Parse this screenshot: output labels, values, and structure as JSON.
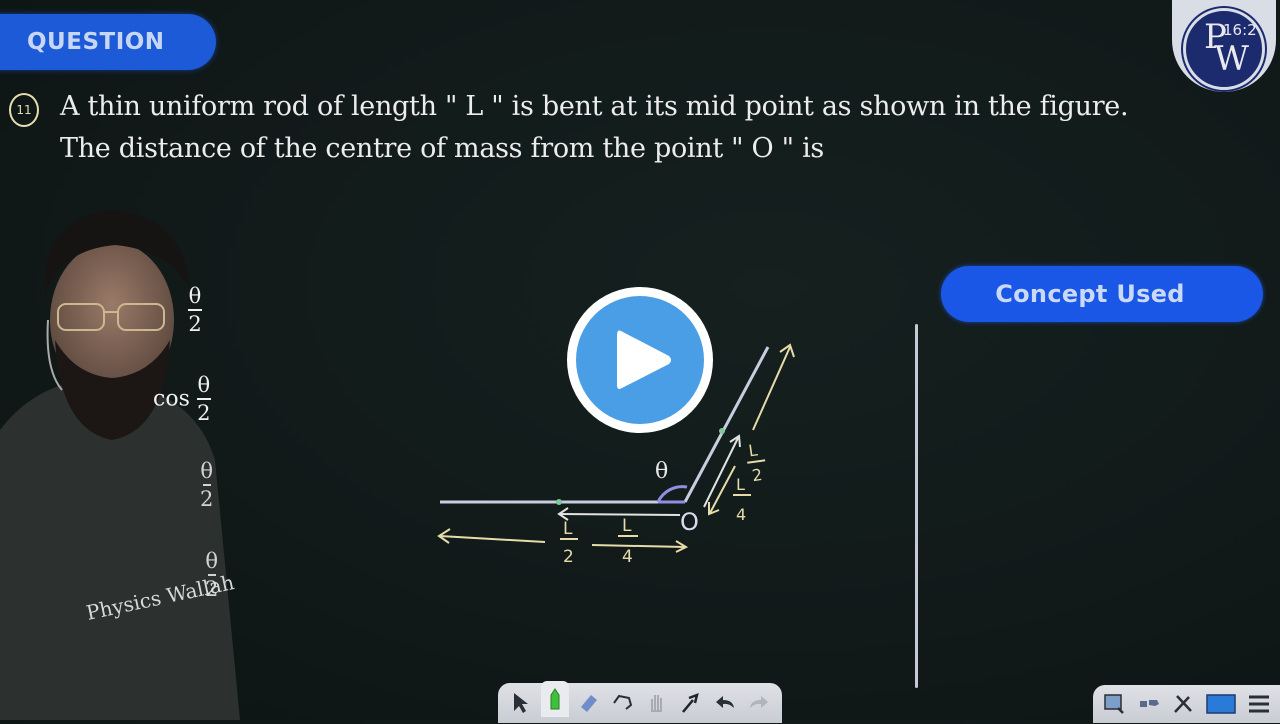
{
  "header": {
    "badge_label": "QUESTION",
    "logo_letters_top": "P",
    "logo_letters_bottom": "W",
    "timestamp_fragment": "16:2"
  },
  "question": {
    "number": "11",
    "line1": "A thin uniform rod of length \" L \" is bent at its mid point as shown in the figure.",
    "line2": "The distance of the centre of mass from the point \" O \" is"
  },
  "side_panel": {
    "concept_button_label": "Concept Used"
  },
  "options_fragments": [
    {
      "prefix": "",
      "num": "θ",
      "den": "2"
    },
    {
      "prefix": "cos",
      "num": "θ",
      "den": "2"
    },
    {
      "prefix": "",
      "num": "θ",
      "den": "2"
    },
    {
      "prefix": "",
      "num": "θ",
      "den": "2"
    }
  ],
  "presenter": {
    "shirt_text": "Physics Wallah"
  },
  "figure": {
    "angle_label": "θ",
    "point_label": "O",
    "labels": {
      "half_length_horizontal": {
        "num": "L",
        "den": "2"
      },
      "quarter_length_horizontal": {
        "num": "L",
        "den": "4"
      },
      "half_length_inclined": {
        "num": "L",
        "den": "2"
      },
      "quarter_length_inclined": {
        "num": "L",
        "den": "4"
      }
    },
    "colors": {
      "rod": "#c9cde0",
      "annotation": "#e6dcaa",
      "midpoint": "#7fc89a",
      "angle_arc": "#8f8fe0"
    }
  },
  "player": {
    "play_button_color": "#4a9ee6"
  },
  "toolbar": {
    "tools": [
      "select-arrow",
      "pen",
      "eraser",
      "lasso",
      "hand",
      "laser-pointer",
      "undo",
      "redo"
    ],
    "active_tool": "pen"
  },
  "toolbar_right": {
    "tools": [
      "zoom-area",
      "shapes",
      "tools",
      "screen",
      "menu"
    ]
  },
  "colors": {
    "background": "#111a19",
    "accent_blue": "#1a57e6",
    "badge_text": "#c7d6f2"
  }
}
